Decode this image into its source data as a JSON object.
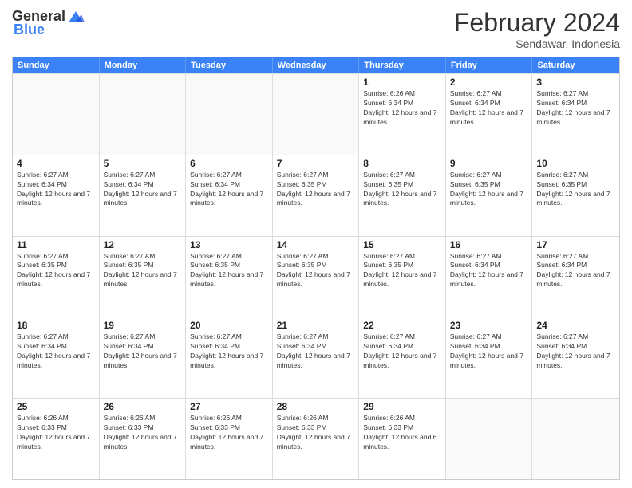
{
  "logo": {
    "general": "General",
    "blue": "Blue"
  },
  "title": "February 2024",
  "location": "Sendawar, Indonesia",
  "days": [
    "Sunday",
    "Monday",
    "Tuesday",
    "Wednesday",
    "Thursday",
    "Friday",
    "Saturday"
  ],
  "weeks": [
    [
      {
        "day": "",
        "info": ""
      },
      {
        "day": "",
        "info": ""
      },
      {
        "day": "",
        "info": ""
      },
      {
        "day": "",
        "info": ""
      },
      {
        "day": "1",
        "info": "Sunrise: 6:26 AM\nSunset: 6:34 PM\nDaylight: 12 hours and 7 minutes."
      },
      {
        "day": "2",
        "info": "Sunrise: 6:27 AM\nSunset: 6:34 PM\nDaylight: 12 hours and 7 minutes."
      },
      {
        "day": "3",
        "info": "Sunrise: 6:27 AM\nSunset: 6:34 PM\nDaylight: 12 hours and 7 minutes."
      }
    ],
    [
      {
        "day": "4",
        "info": "Sunrise: 6:27 AM\nSunset: 6:34 PM\nDaylight: 12 hours and 7 minutes."
      },
      {
        "day": "5",
        "info": "Sunrise: 6:27 AM\nSunset: 6:34 PM\nDaylight: 12 hours and 7 minutes."
      },
      {
        "day": "6",
        "info": "Sunrise: 6:27 AM\nSunset: 6:34 PM\nDaylight: 12 hours and 7 minutes."
      },
      {
        "day": "7",
        "info": "Sunrise: 6:27 AM\nSunset: 6:35 PM\nDaylight: 12 hours and 7 minutes."
      },
      {
        "day": "8",
        "info": "Sunrise: 6:27 AM\nSunset: 6:35 PM\nDaylight: 12 hours and 7 minutes."
      },
      {
        "day": "9",
        "info": "Sunrise: 6:27 AM\nSunset: 6:35 PM\nDaylight: 12 hours and 7 minutes."
      },
      {
        "day": "10",
        "info": "Sunrise: 6:27 AM\nSunset: 6:35 PM\nDaylight: 12 hours and 7 minutes."
      }
    ],
    [
      {
        "day": "11",
        "info": "Sunrise: 6:27 AM\nSunset: 6:35 PM\nDaylight: 12 hours and 7 minutes."
      },
      {
        "day": "12",
        "info": "Sunrise: 6:27 AM\nSunset: 6:35 PM\nDaylight: 12 hours and 7 minutes."
      },
      {
        "day": "13",
        "info": "Sunrise: 6:27 AM\nSunset: 6:35 PM\nDaylight: 12 hours and 7 minutes."
      },
      {
        "day": "14",
        "info": "Sunrise: 6:27 AM\nSunset: 6:35 PM\nDaylight: 12 hours and 7 minutes."
      },
      {
        "day": "15",
        "info": "Sunrise: 6:27 AM\nSunset: 6:35 PM\nDaylight: 12 hours and 7 minutes."
      },
      {
        "day": "16",
        "info": "Sunrise: 6:27 AM\nSunset: 6:34 PM\nDaylight: 12 hours and 7 minutes."
      },
      {
        "day": "17",
        "info": "Sunrise: 6:27 AM\nSunset: 6:34 PM\nDaylight: 12 hours and 7 minutes."
      }
    ],
    [
      {
        "day": "18",
        "info": "Sunrise: 6:27 AM\nSunset: 6:34 PM\nDaylight: 12 hours and 7 minutes."
      },
      {
        "day": "19",
        "info": "Sunrise: 6:27 AM\nSunset: 6:34 PM\nDaylight: 12 hours and 7 minutes."
      },
      {
        "day": "20",
        "info": "Sunrise: 6:27 AM\nSunset: 6:34 PM\nDaylight: 12 hours and 7 minutes."
      },
      {
        "day": "21",
        "info": "Sunrise: 6:27 AM\nSunset: 6:34 PM\nDaylight: 12 hours and 7 minutes."
      },
      {
        "day": "22",
        "info": "Sunrise: 6:27 AM\nSunset: 6:34 PM\nDaylight: 12 hours and 7 minutes."
      },
      {
        "day": "23",
        "info": "Sunrise: 6:27 AM\nSunset: 6:34 PM\nDaylight: 12 hours and 7 minutes."
      },
      {
        "day": "24",
        "info": "Sunrise: 6:27 AM\nSunset: 6:34 PM\nDaylight: 12 hours and 7 minutes."
      }
    ],
    [
      {
        "day": "25",
        "info": "Sunrise: 6:26 AM\nSunset: 6:33 PM\nDaylight: 12 hours and 7 minutes."
      },
      {
        "day": "26",
        "info": "Sunrise: 6:26 AM\nSunset: 6:33 PM\nDaylight: 12 hours and 7 minutes."
      },
      {
        "day": "27",
        "info": "Sunrise: 6:26 AM\nSunset: 6:33 PM\nDaylight: 12 hours and 7 minutes."
      },
      {
        "day": "28",
        "info": "Sunrise: 6:26 AM\nSunset: 6:33 PM\nDaylight: 12 hours and 7 minutes."
      },
      {
        "day": "29",
        "info": "Sunrise: 6:26 AM\nSunset: 6:33 PM\nDaylight: 12 hours and 6 minutes."
      },
      {
        "day": "",
        "info": ""
      },
      {
        "day": "",
        "info": ""
      }
    ]
  ]
}
